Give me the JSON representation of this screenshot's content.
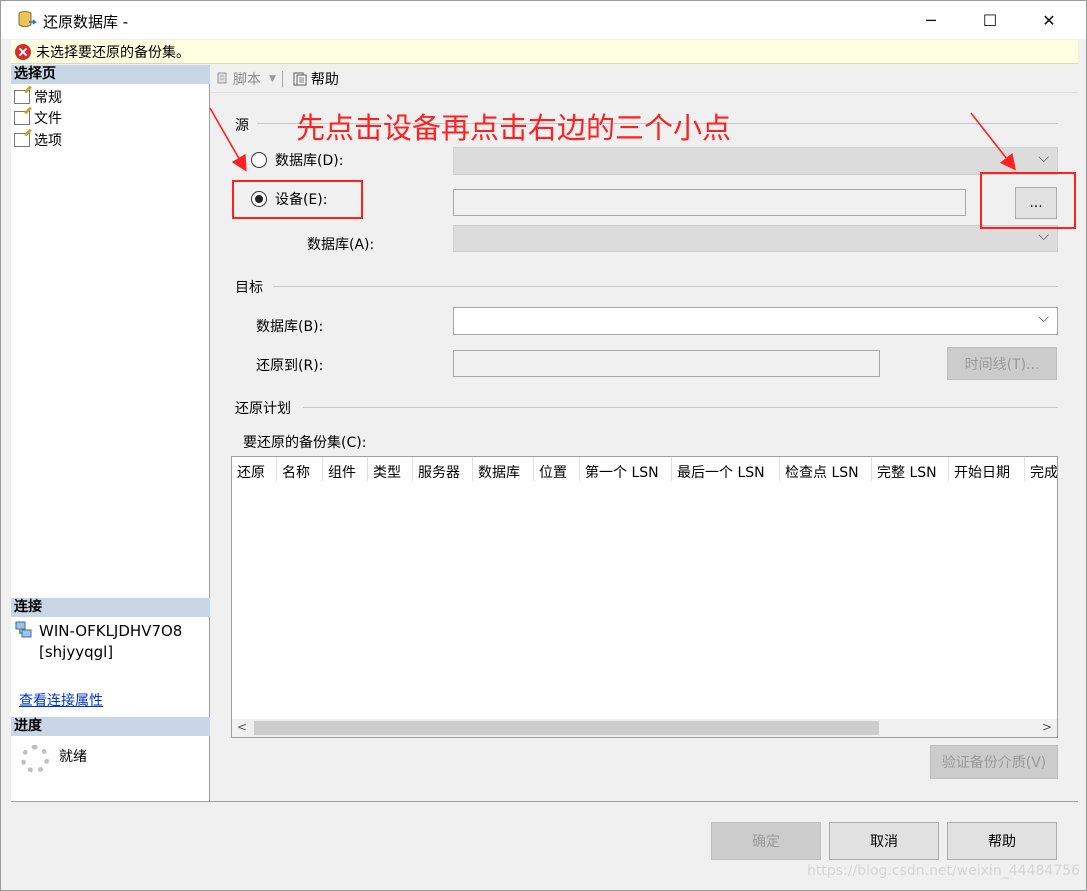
{
  "window": {
    "title": "还原数据库 -",
    "controls": {
      "minimize": "─",
      "maximize": "☐",
      "close": "✕"
    }
  },
  "error_bar": {
    "message": "未选择要还原的备份集。"
  },
  "left_pane": {
    "select_page_header": "选择页",
    "nav_items": [
      {
        "label": "常规"
      },
      {
        "label": "文件"
      },
      {
        "label": "选项"
      }
    ],
    "connection_header": "连接",
    "server": "WIN-OFKLJDHV7O8",
    "user": "[shjyyqgl]",
    "view_connection_link": "查看连接属性",
    "progress_header": "进度",
    "progress_status": "就绪"
  },
  "toolbar": {
    "script_label": "脚本",
    "help_label": "帮助"
  },
  "source": {
    "section_label": "源",
    "database_radio": "数据库(D):",
    "device_radio": "设备(E):",
    "device_value": "",
    "browse_button": "...",
    "database_label": "数据库(A):"
  },
  "target": {
    "section_label": "目标",
    "database_label": "数据库(B):",
    "restore_to_label": "还原到(R):",
    "timeline_button": "时间线(T)..."
  },
  "restore_plan": {
    "section_label": "还原计划",
    "backup_sets_label": "要还原的备份集(C):",
    "columns": [
      "还原",
      "名称",
      "组件",
      "类型",
      "服务器",
      "数据库",
      "位置",
      "第一个 LSN",
      "最后一个 LSN",
      "检查点 LSN",
      "完整 LSN",
      "开始日期",
      "完成"
    ],
    "verify_button": "验证备份介质(V)"
  },
  "footer": {
    "ok_button": "确定",
    "cancel_button": "取消",
    "help_button": "帮助"
  },
  "annotation": {
    "text": "先点击设备再点击右边的三个小点",
    "color": "#ff2020"
  },
  "watermark": "https://blog.csdn.net/weixin_44484756"
}
